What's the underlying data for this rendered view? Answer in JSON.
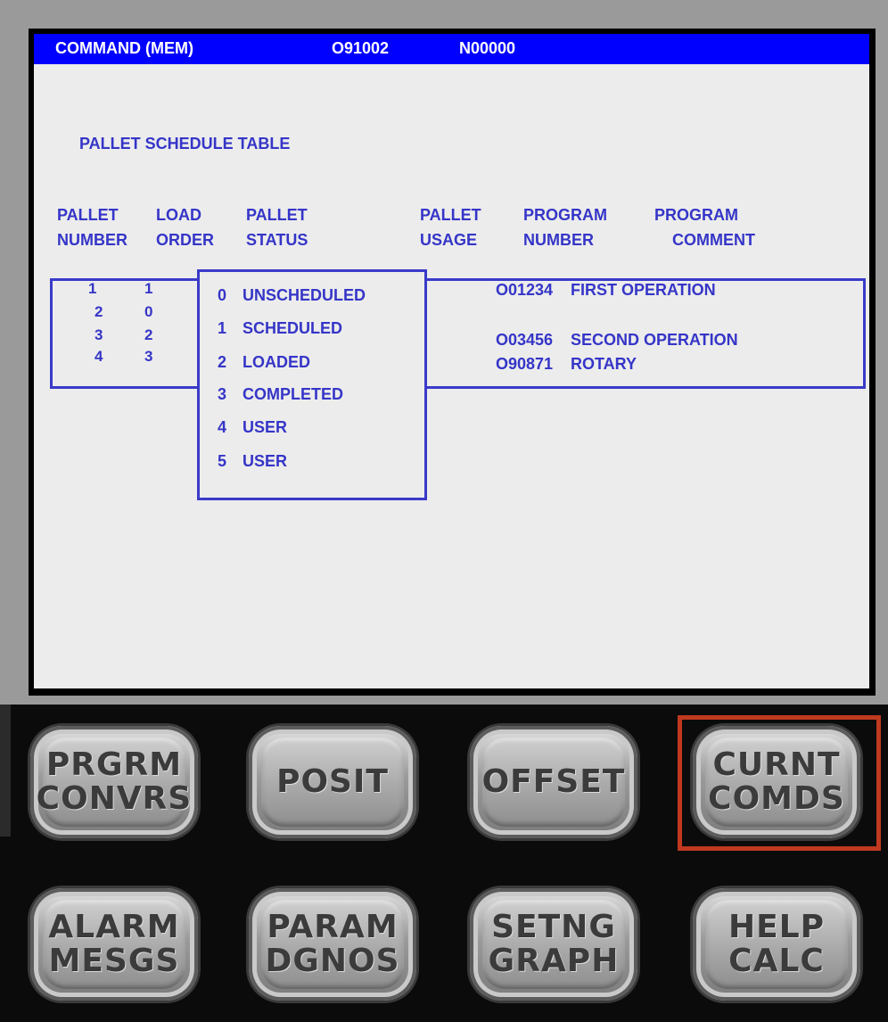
{
  "titlebar": {
    "mode": "COMMAND (MEM)",
    "program": "O91002",
    "sequence": "N00000"
  },
  "screen_title": "PALLET SCHEDULE TABLE",
  "headers": {
    "pallet_number": [
      "PALLET",
      "NUMBER"
    ],
    "load_order": [
      "LOAD",
      "ORDER"
    ],
    "pallet_status": [
      "PALLET",
      "STATUS"
    ],
    "pallet_usage": [
      "PALLET",
      "USAGE"
    ],
    "program_number": [
      "PROGRAM",
      "NUMBER"
    ],
    "program_comment": [
      "PROGRAM",
      "COMMENT"
    ]
  },
  "rows": [
    {
      "pallet": "1",
      "load_order": "1"
    },
    {
      "pallet": "2",
      "load_order": "0"
    },
    {
      "pallet": "3",
      "load_order": "2"
    },
    {
      "pallet": "4",
      "load_order": "3"
    }
  ],
  "programs": [
    {
      "number": "O01234",
      "comment": "FIRST OPERATION"
    },
    {
      "number": "O03456",
      "comment": "SECOND OPERATION"
    },
    {
      "number": "O90871",
      "comment": "ROTARY"
    }
  ],
  "status_options": [
    {
      "code": "0",
      "label": "UNSCHEDULED"
    },
    {
      "code": "1",
      "label": "SCHEDULED"
    },
    {
      "code": "2",
      "label": "LOADED"
    },
    {
      "code": "3",
      "label": "COMPLETED"
    },
    {
      "code": "4",
      "label": "USER"
    },
    {
      "code": "5",
      "label": "USER"
    }
  ],
  "keys": [
    {
      "line1": "PRGRM",
      "line2": "CONVRS"
    },
    {
      "line1": "POSIT",
      "line2": ""
    },
    {
      "line1": "OFFSET",
      "line2": ""
    },
    {
      "line1": "CURNT",
      "line2": "COMDS"
    },
    {
      "line1": "ALARM",
      "line2": "MESGS"
    },
    {
      "line1": "PARAM",
      "line2": "DGNOS"
    },
    {
      "line1": "SETNG",
      "line2": "GRAPH"
    },
    {
      "line1": "HELP",
      "line2": "CALC"
    }
  ],
  "colors": {
    "titlebar_bg": "#0000ff",
    "text_blue": "#3535c8",
    "highlight": "#c0391f"
  },
  "highlighted_key": "CURNT COMDS"
}
